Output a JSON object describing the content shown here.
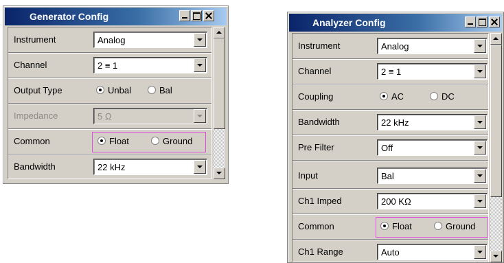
{
  "generator": {
    "title": "Generator Config",
    "rows": [
      {
        "label": "Instrument",
        "value": "Analog"
      },
      {
        "label": "Channel",
        "value": "2 ≡ 1"
      },
      {
        "label": "Output Type",
        "opt1": "Unbal",
        "opt2": "Bal",
        "selected": "Unbal"
      },
      {
        "label": "Impedance",
        "value": "5 Ω",
        "disabled": true
      },
      {
        "label": "Common",
        "opt1": "Float",
        "opt2": "Ground",
        "selected": "Float",
        "highlighted": true
      },
      {
        "label": "Bandwidth",
        "value": "22 kHz"
      }
    ]
  },
  "analyzer": {
    "title": "Analyzer Config",
    "rows": [
      {
        "label": "Instrument",
        "value": "Analog"
      },
      {
        "label": "Channel",
        "value": "2 ≡ 1"
      },
      {
        "label": "Coupling",
        "opt1": "AC",
        "opt2": "DC",
        "selected": "AC"
      },
      {
        "label": "Bandwidth",
        "value": "22 kHz"
      },
      {
        "label": "Pre Filter",
        "value": "Off"
      },
      {
        "label": "Input",
        "value": "Bal"
      },
      {
        "label": "Ch1 Imped",
        "value": "200 KΩ"
      },
      {
        "label": "Common",
        "opt1": "Float",
        "opt2": "Ground",
        "selected": "Float",
        "highlighted": true
      },
      {
        "label": "Ch1 Range",
        "value": "Auto"
      }
    ]
  },
  "colors": {
    "highlight_border": "#e04ee0",
    "title_bar": "#0a246a",
    "panel": "#d4d0c8"
  },
  "icons": [
    "minimize-icon",
    "maximize-icon",
    "close-icon",
    "scroll-up-icon",
    "scroll-down-icon",
    "dropdown-arrow-icon",
    "radio-button-icon"
  ]
}
